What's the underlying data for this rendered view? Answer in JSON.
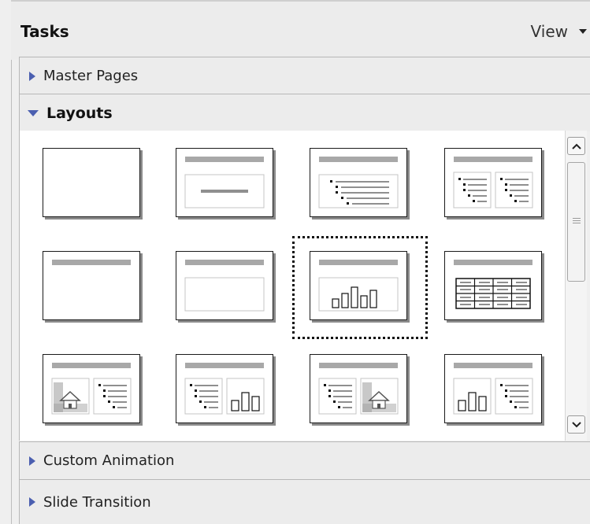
{
  "panel": {
    "title": "Tasks",
    "view_label": "View"
  },
  "sections": {
    "master_pages": "Master Pages",
    "layouts": "Layouts",
    "custom_animation": "Custom Animation",
    "slide_transition": "Slide Transition"
  },
  "layouts": {
    "items": [
      "blank",
      "title-only-centered",
      "title-bulleted-text",
      "title-two-columns",
      "title-only",
      "title-content-placeholder",
      "title-chart",
      "title-table",
      "title-clipart-text",
      "title-text-chart",
      "title-text-clipart",
      "title-chart-text"
    ],
    "selected_index": 6
  },
  "colors": {
    "accent": "#4b5fb0",
    "panel_bg": "#ececec",
    "border": "#b7b7b7"
  },
  "icons": {
    "expand": "triangle-right-icon",
    "collapse": "triangle-down-icon",
    "view_menu": "dropdown-arrow-icon"
  }
}
